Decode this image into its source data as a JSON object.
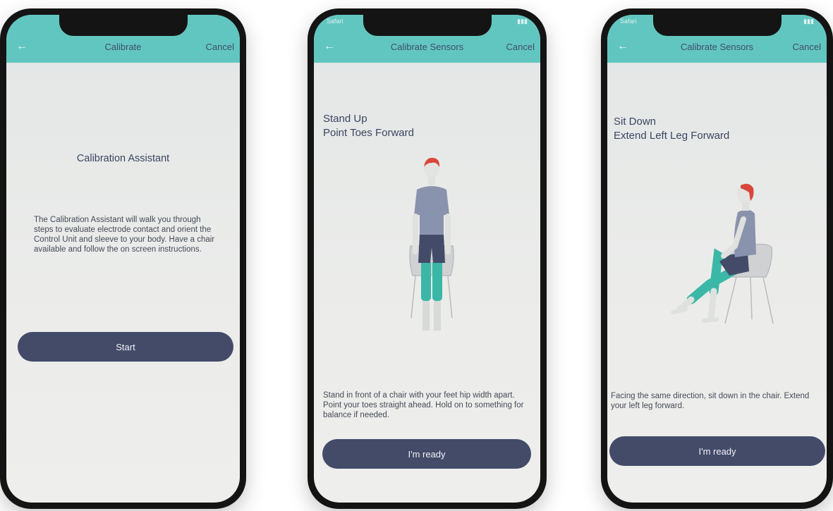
{
  "screens": [
    {
      "nav": {
        "back_icon": "arrow-left-icon",
        "title": "Calibrate",
        "cancel": "Cancel"
      },
      "heading": "Calibration Assistant",
      "body": "The Calibration Assistant will walk you through steps to evaluate electrode contact and orient the Control Unit and sleeve to your body. Have a chair available and follow the on screen instructions.",
      "button": "Start"
    },
    {
      "status": {
        "carrier": "Safari",
        "icons": "signal-battery"
      },
      "nav": {
        "back_icon": "arrow-left-icon",
        "title": "Calibrate Sensors",
        "cancel": "Cancel"
      },
      "heading_line1": "Stand Up",
      "heading_line2": "Point Toes Forward",
      "body": "Stand in front of a chair with your feet hip width apart. Point your toes straight ahead. Hold on to something for balance if needed.",
      "button": "I'm ready"
    },
    {
      "status": {
        "carrier": "Safari",
        "icons": "signal-battery"
      },
      "nav": {
        "back_icon": "arrow-left-icon",
        "title": "Calibrate Sensors",
        "cancel": "Cancel"
      },
      "heading_line1": "Sit Down",
      "heading_line2": "Extend Left Leg Forward",
      "body": "Facing the same direction, sit down in the chair. Extend your left leg forward.",
      "button": "I'm ready"
    }
  ],
  "colors": {
    "accent": "#62c6c0",
    "button": "#434b69",
    "text": "#3b4560",
    "sleeve": "#3bb7a7",
    "shirt": "#8a93ad",
    "shorts": "#434b69",
    "hair": "#d9473a",
    "chair": "#c9cbcc"
  }
}
